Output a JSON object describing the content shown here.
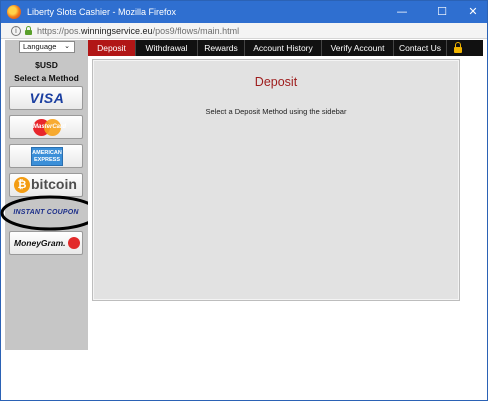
{
  "window": {
    "title": "Liberty Slots Cashier - Mozilla Firefox",
    "controls": {
      "minimize": "—",
      "maximize": "☐",
      "close": "✕"
    }
  },
  "address_bar": {
    "url_prefix": "https://pos.",
    "url_domain": "winningservice.eu",
    "url_path": "/pos9/flows/main.html"
  },
  "sidebar": {
    "language_select": "Language",
    "currency": "$USD",
    "select_method_label": "Select a Method",
    "methods": [
      {
        "name": "visa",
        "label": "VISA"
      },
      {
        "name": "mastercard",
        "label": "MasterCard"
      },
      {
        "name": "amex",
        "label": "AMERICAN\nEXPRESS"
      },
      {
        "name": "bitcoin",
        "label": "bitcoin",
        "symbol": "₿"
      },
      {
        "name": "instant-coupon",
        "label": "INSTANT COUPON"
      },
      {
        "name": "moneygram",
        "label": "MoneyGram."
      }
    ]
  },
  "nav": {
    "tabs": [
      {
        "label": "Deposit",
        "active": true
      },
      {
        "label": "Withdrawal",
        "active": false
      },
      {
        "label": "Rewards",
        "active": false
      },
      {
        "label": "Account History",
        "active": false
      },
      {
        "label": "Verify Account",
        "active": false
      },
      {
        "label": "Contact Us",
        "active": false
      }
    ],
    "lock_icon": "lock-icon"
  },
  "content": {
    "title": "Deposit",
    "message": "Select a Deposit Method using the sidebar"
  },
  "colors": {
    "titlebar": "#2f6fd0",
    "active_tab": "#b11616",
    "nav_bg": "#111111",
    "content_title": "#9e1c1c",
    "sidebar_bg": "#c6c6c6",
    "annotation_ellipse": "#000000"
  }
}
